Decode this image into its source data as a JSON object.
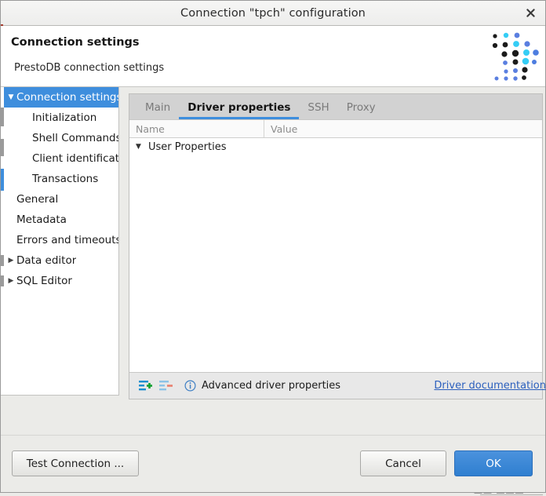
{
  "window": {
    "title": "Connection \"tpch\" configuration",
    "close_icon": "close-icon"
  },
  "header": {
    "title": "Connection settings",
    "subtitle": "PrestoDB connection settings",
    "logo_name": "dbeaver-logo"
  },
  "sidebar": {
    "items": [
      {
        "label": "Connection settings",
        "indent": 1,
        "twisty": "▼",
        "selected": true
      },
      {
        "label": "Initialization",
        "indent": 2,
        "twisty": "",
        "selected": false
      },
      {
        "label": "Shell Commands",
        "indent": 2,
        "twisty": "",
        "selected": false
      },
      {
        "label": "Client identification",
        "indent": 2,
        "twisty": "",
        "selected": false
      },
      {
        "label": "Transactions",
        "indent": 2,
        "twisty": "",
        "selected": false
      },
      {
        "label": "General",
        "indent": 1,
        "twisty": "",
        "selected": false
      },
      {
        "label": "Metadata",
        "indent": 1,
        "twisty": "",
        "selected": false
      },
      {
        "label": "Errors and timeouts",
        "indent": 1,
        "twisty": "",
        "selected": false
      },
      {
        "label": "Data editor",
        "indent": 1,
        "twisty": "▶",
        "selected": false
      },
      {
        "label": "SQL Editor",
        "indent": 1,
        "twisty": "▶",
        "selected": false
      }
    ]
  },
  "content": {
    "tabs": [
      {
        "label": "Main",
        "active": false
      },
      {
        "label": "Driver properties",
        "active": true
      },
      {
        "label": "SSH",
        "active": false
      },
      {
        "label": "Proxy",
        "active": false
      }
    ],
    "table": {
      "columns": [
        "Name",
        "Value"
      ],
      "rows": [
        {
          "name": "User Properties",
          "value": "",
          "twisty": "▼",
          "group": true
        }
      ]
    },
    "footer": {
      "add_icon": "add-property-icon",
      "remove_icon": "remove-property-icon",
      "info_icon": "info-icon",
      "info_text": "Advanced driver properties",
      "doc_link": "Driver documentation"
    }
  },
  "buttons": {
    "test": "Test Connection ...",
    "cancel": "Cancel",
    "ok": "OK"
  },
  "colors": {
    "accent": "#3e8edd",
    "ok_button": "#2f7fd0",
    "link": "#2b5fbd",
    "add_plus": "#10a030",
    "remove_minus": "#e8806f",
    "window_bg": "#ebebe8"
  },
  "background_fragment": "——  ———"
}
